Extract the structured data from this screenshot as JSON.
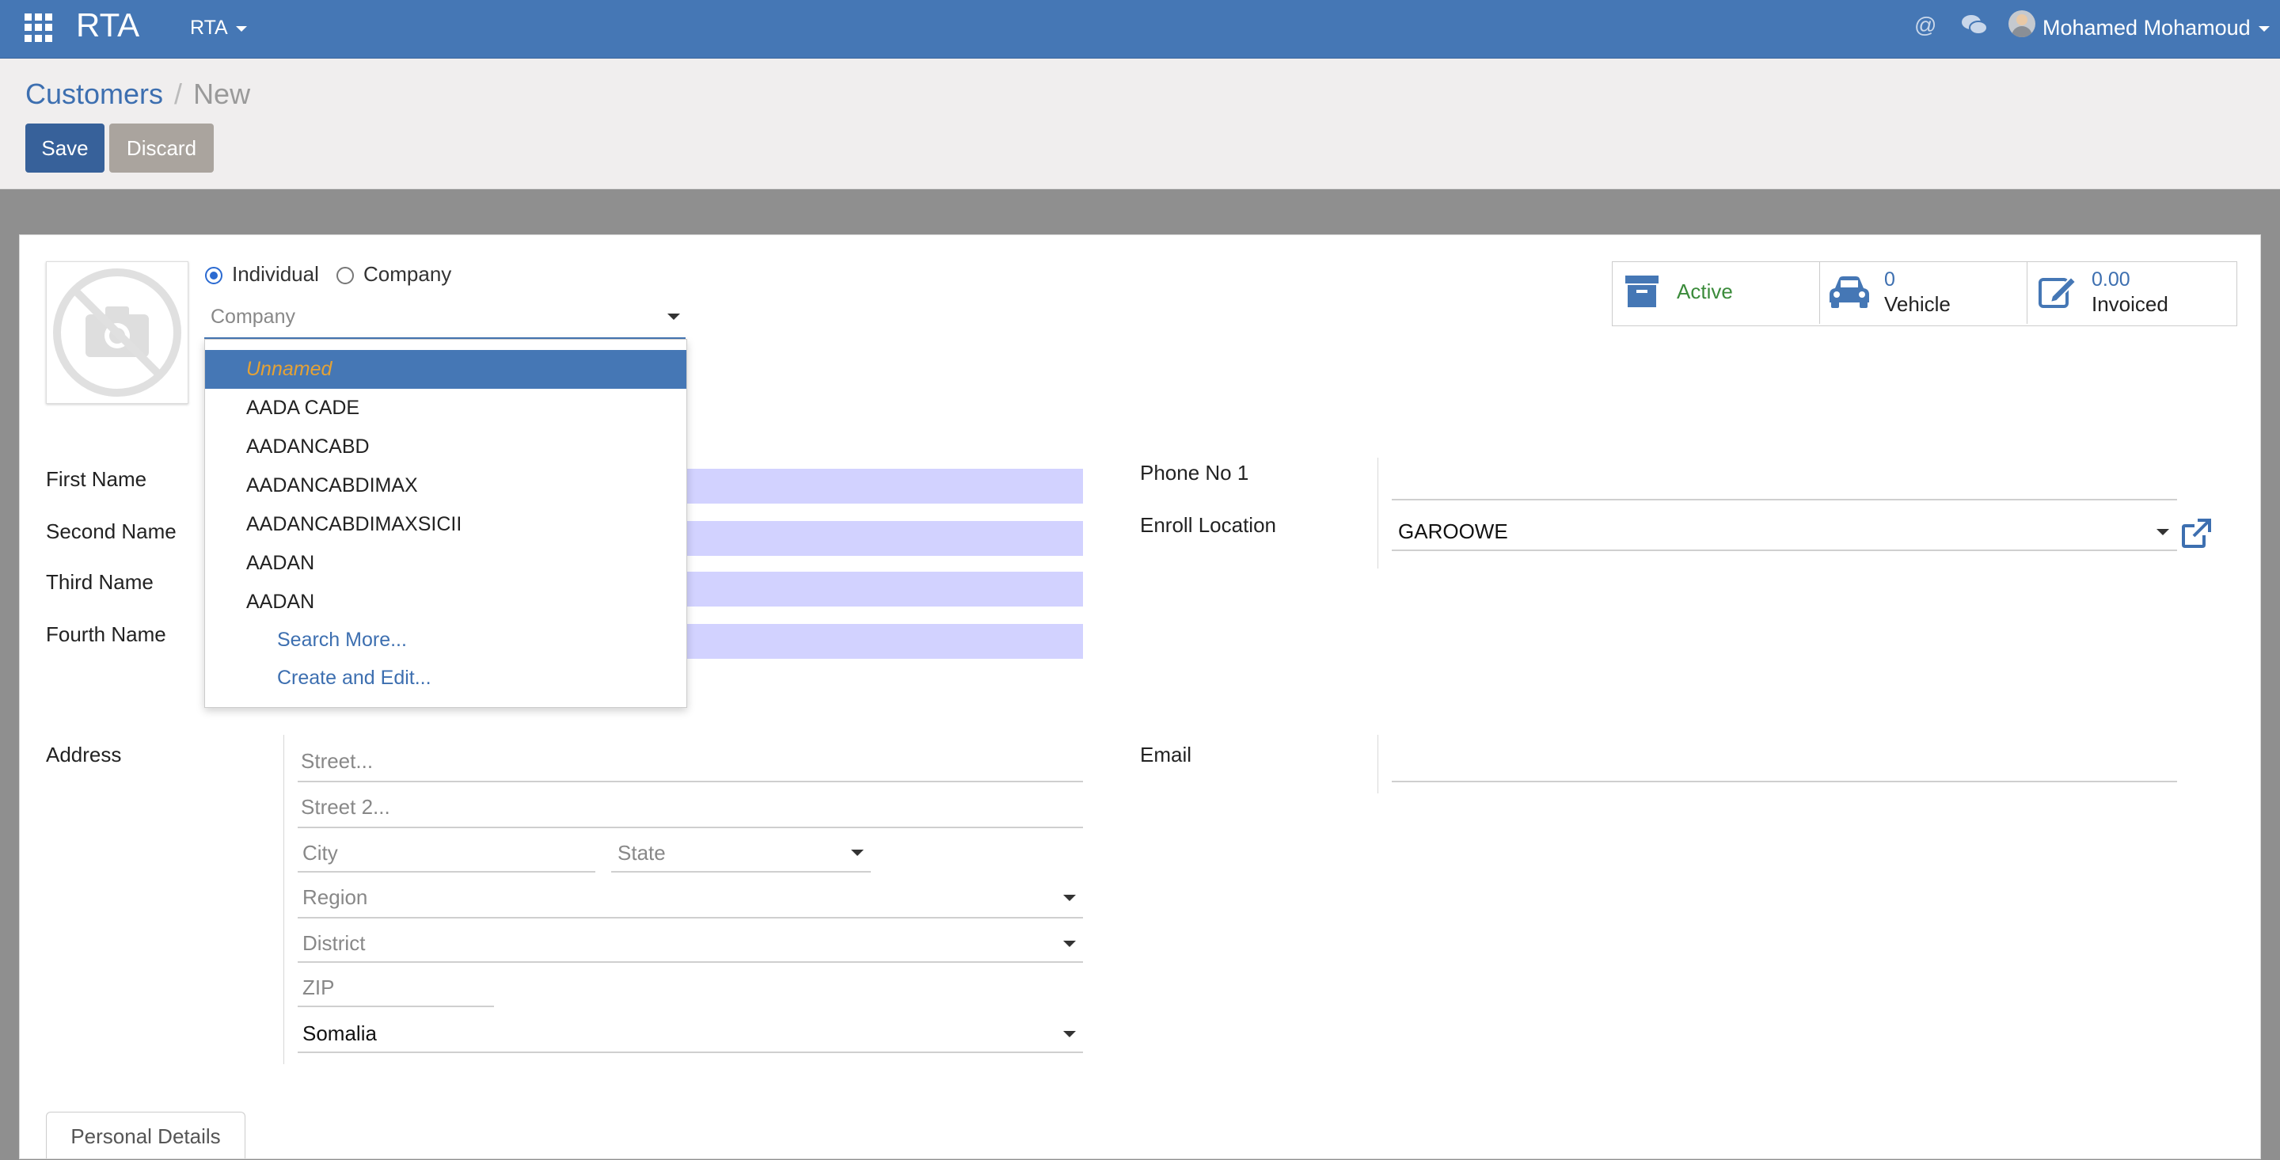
{
  "navbar": {
    "brand": "RTA",
    "menu": "RTA",
    "at_icon": "@",
    "user_name": "Mohamed Mohamoud"
  },
  "breadcrumb": {
    "parent": "Customers",
    "separator": "/",
    "current": "New"
  },
  "buttons": {
    "save": "Save",
    "discard": "Discard"
  },
  "partner_type": {
    "individual": "Individual",
    "company": "Company",
    "selected": "Individual"
  },
  "company_field": {
    "placeholder": "Company"
  },
  "company_dropdown": {
    "items": [
      "Unnamed",
      "AADA CADE",
      "AADANCABD",
      "AADANCABDIMAX",
      "AADANCABDIMAXSICII",
      "AADAN",
      "AADAN"
    ],
    "search_more": "Search More...",
    "create_edit": "Create and Edit..."
  },
  "stats": {
    "active": "Active",
    "vehicle_count": "0",
    "vehicle_label": "Vehicle",
    "invoiced_amount": "0.00",
    "invoiced_label": "Invoiced"
  },
  "labels": {
    "first_name": "First Name",
    "second_name": "Second Name",
    "third_name": "Third Name",
    "fourth_name": "Fourth Name",
    "phone1": "Phone No 1",
    "enroll_location": "Enroll Location",
    "address": "Address",
    "email": "Email"
  },
  "enroll_location_value": "GAROOWE",
  "address": {
    "street": "Street...",
    "street2": "Street 2...",
    "city": "City",
    "state": "State",
    "region": "Region",
    "district": "District",
    "zip": "ZIP",
    "country": "Somalia"
  },
  "tabs": {
    "personal_details": "Personal Details"
  },
  "colors": {
    "navbar": "#4577b5",
    "primary_button": "#37619a",
    "highlight_input": "#d2d2ff",
    "active_status": "#3b8b3b"
  }
}
